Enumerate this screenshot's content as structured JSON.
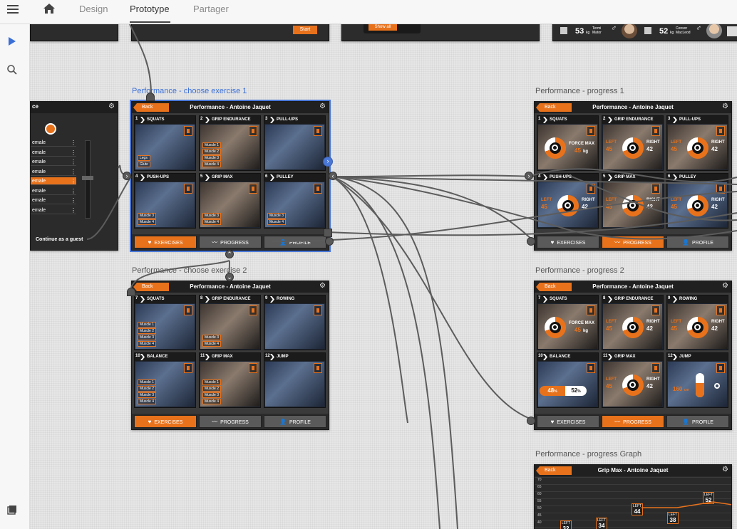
{
  "topbar": {
    "tabs": [
      {
        "label": "Design"
      },
      {
        "label": "Prototype"
      },
      {
        "label": "Partager"
      }
    ]
  },
  "artboards": {
    "choose1": {
      "label": "Performance - choose exercise 1",
      "title": "Performance - Antoine Jaquet",
      "back": "Back",
      "tiles": [
        {
          "num": "1",
          "name": "SQUATS",
          "muscles": [
            "Legs",
            "Glute"
          ]
        },
        {
          "num": "2",
          "name": "GRIP ENDURANCE",
          "muscles": [
            "Muscle 1",
            "Muscle 2",
            "Muscle 3",
            "Muscle 4"
          ]
        },
        {
          "num": "3",
          "name": "PULL-UPS",
          "muscles": []
        },
        {
          "num": "4",
          "name": "PUSH-UPS",
          "muscles": [
            "Muscle 3",
            "Muscle 4"
          ]
        },
        {
          "num": "5",
          "name": "GRIP MAX",
          "muscles": [
            "Muscle 3",
            "Muscle 4"
          ]
        },
        {
          "num": "6",
          "name": "PULLEY",
          "muscles": [
            "Muscle 3",
            "Muscle 4"
          ]
        }
      ],
      "footer": [
        "EXERCISES",
        "PROGRESS",
        "PROFILE"
      ]
    },
    "choose2": {
      "label": "Performance - choose exercise 2",
      "title": "Performance - Antoine Jaquet",
      "back": "Back",
      "tiles": [
        {
          "num": "7",
          "name": "SQUATS",
          "muscles": [
            "Muscle 1",
            "Muscle 2",
            "Muscle 3",
            "Muscle 4"
          ]
        },
        {
          "num": "8",
          "name": "GRIP ENDURANCE",
          "muscles": [
            "Muscle 3",
            "Muscle 4"
          ]
        },
        {
          "num": "9",
          "name": "ROWING",
          "muscles": []
        },
        {
          "num": "10",
          "name": "BALANCE",
          "muscles": [
            "Muscle 1",
            "Muscle 2",
            "Muscle 3",
            "Muscle 4"
          ]
        },
        {
          "num": "11",
          "name": "GRIP MAX",
          "muscles": [
            "Muscle 1",
            "Muscle 2",
            "Muscle 3",
            "Muscle 4"
          ]
        },
        {
          "num": "12",
          "name": "JUMP",
          "muscles": []
        }
      ],
      "footer": [
        "EXERCISES",
        "PROGRESS",
        "PROFILE"
      ]
    },
    "progress1": {
      "label": "Performance - progress 1",
      "title": "Performance - Antoine Jaquet",
      "back": "Back",
      "tiles": [
        {
          "num": "1",
          "name": "SQUATS"
        },
        {
          "num": "2",
          "name": "GRIP ENDURANCE"
        },
        {
          "num": "3",
          "name": "PULL-UPS"
        },
        {
          "num": "4",
          "name": "PUSH-UPS"
        },
        {
          "num": "5",
          "name": "GRIP MAX"
        },
        {
          "num": "6",
          "name": "PULLEY"
        }
      ],
      "force_max": "FORCE MAX",
      "force_val": "45",
      "unit": "kg",
      "left": "LEFT",
      "right": "RIGHT",
      "left_val": "45",
      "right_val": "42",
      "footer": [
        "EXERCISES",
        "PROGRESS",
        "PROFILE"
      ]
    },
    "progress2": {
      "label": "Performance - progress 2",
      "title": "Performance - Antoine Jaquet",
      "back": "Back",
      "tiles": [
        {
          "num": "7",
          "name": "SQUATS"
        },
        {
          "num": "8",
          "name": "GRIP ENDURANCE"
        },
        {
          "num": "9",
          "name": "ROWING"
        },
        {
          "num": "10",
          "name": "BALANCE"
        },
        {
          "num": "11",
          "name": "GRIP MAX"
        },
        {
          "num": "12",
          "name": "JUMP"
        }
      ],
      "force_max": "FORCE MAX",
      "force_val": "45",
      "unit": "kg",
      "left": "LEFT",
      "right": "RIGHT",
      "left_val": "45",
      "right_val": "42",
      "balance_left": "48",
      "balance_right": "52",
      "pct": "%",
      "jump_val": "160",
      "jump_unit": "cm",
      "footer": [
        "EXERCISES",
        "PROGRESS",
        "PROFILE"
      ]
    },
    "graph": {
      "label": "Performance - progress Graph",
      "title": "Grip Max - Antoine Jaquet",
      "back": "Back",
      "yticks": [
        "70",
        "65",
        "60",
        "55",
        "50",
        "45",
        "40"
      ],
      "points": [
        {
          "lbl": "LEFT",
          "v": "32"
        },
        {
          "lbl": "LEFT",
          "v": "34"
        },
        {
          "lbl": "LEFT",
          "v": "44"
        },
        {
          "lbl": "LEFT",
          "v": "38"
        },
        {
          "lbl": "LEFT",
          "v": "52"
        }
      ]
    },
    "login": {
      "header": "ce",
      "rows": [
        "emale",
        "emale",
        "emale",
        "emale",
        "emale",
        "emale",
        "emale",
        "emale"
      ],
      "guest": "Continue as a guest"
    },
    "top_strip": {
      "start": "Start",
      "show_all": "Show all",
      "user1": {
        "weight": "53",
        "unit": "kg",
        "name": "Termi Mator"
      },
      "user2": {
        "weight": "52",
        "unit": "kg",
        "name": "Censor MacLeod"
      }
    }
  }
}
